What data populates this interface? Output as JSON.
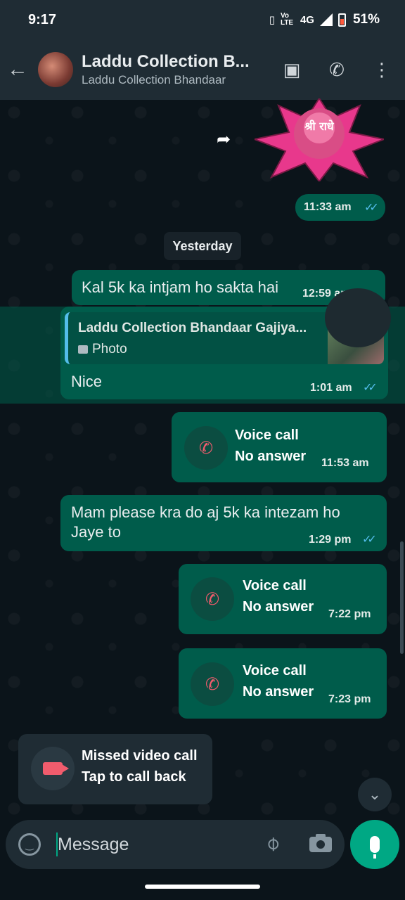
{
  "status_bar": {
    "time": "9:17",
    "network": "4G",
    "volte": "Vo LTE",
    "battery": "51%"
  },
  "header": {
    "title": "Laddu Collection B...",
    "subtitle": "Laddu Collection Bhandaar"
  },
  "messages": {
    "sticker": {
      "text": "श्री राधे",
      "time": "11:33 am"
    },
    "day_separator": "Yesterday",
    "msg1": {
      "text": "Kal 5k ka intjam ho sakta hai",
      "time": "12:59 am"
    },
    "reply": {
      "quote_author": "Laddu Collection Bhandaar Gajiya...",
      "quote_type": "Photo",
      "text": "Nice",
      "time": "1:01 am"
    },
    "call1": {
      "title": "Voice call",
      "status": "No answer",
      "time": "11:53 am"
    },
    "msg2": {
      "line1": "Mam please kra do aj 5k ka intezam ho",
      "line2": "Jaye to",
      "time": "1:29 pm"
    },
    "call2": {
      "title": "Voice call",
      "status": "No answer",
      "time": "7:22 pm"
    },
    "call3": {
      "title": "Voice call",
      "status": "No answer",
      "time": "7:23 pm"
    },
    "missed": {
      "title": "Missed video call",
      "subtitle": "Tap to call back"
    }
  },
  "input": {
    "placeholder": "Message"
  },
  "colors": {
    "bubble_out": "#005c4b",
    "accent": "#00a884",
    "read_ticks": "#53bdeb",
    "missed": "#f15c6d"
  }
}
